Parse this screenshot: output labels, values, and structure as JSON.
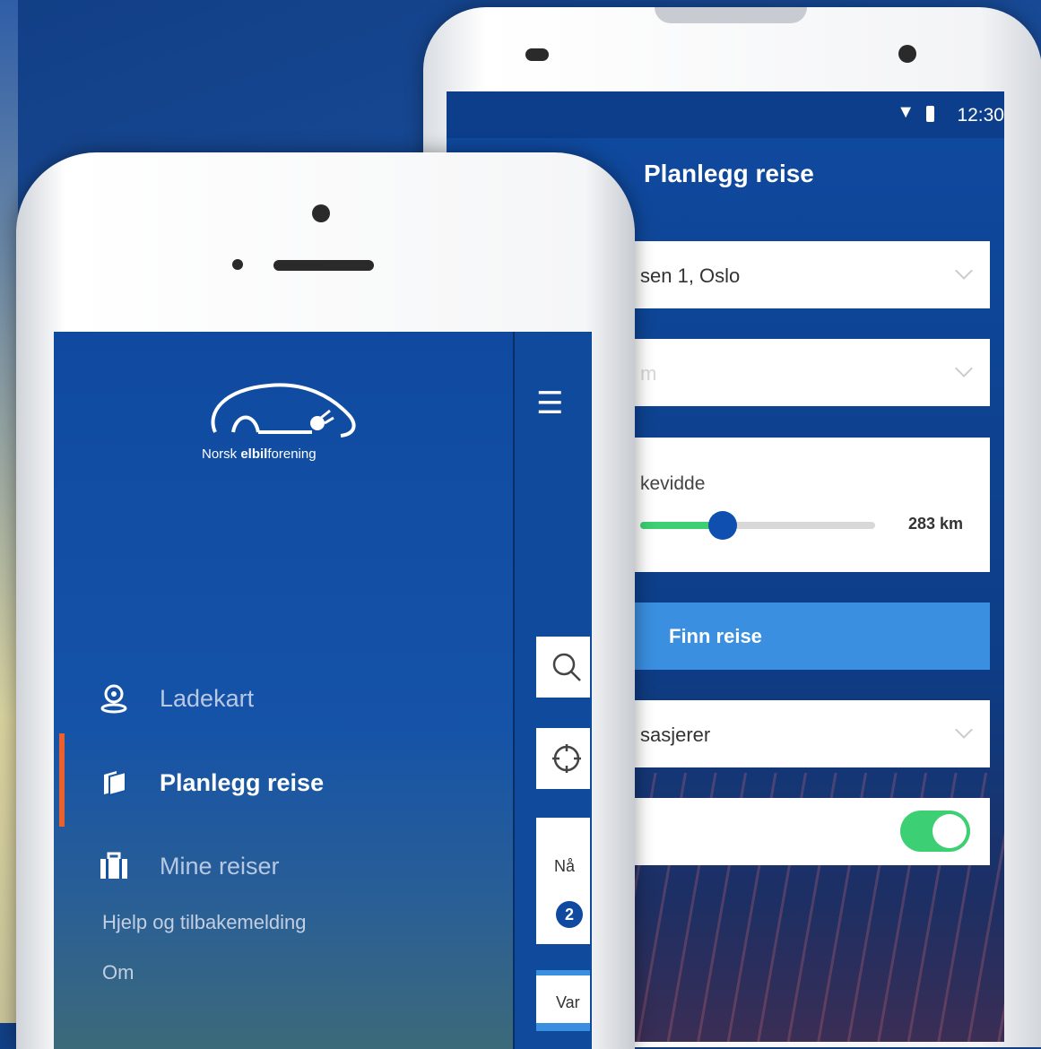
{
  "android": {
    "status": {
      "time": "12:30"
    },
    "title": "Planlegg reise",
    "from_text": "sen 1, Oslo",
    "to_text": "m",
    "range": {
      "label": "kevidde",
      "value_text": "283 km",
      "fill_fraction": 0.35
    },
    "find_button": "Finn reise",
    "passengers_text": "sasjerer",
    "toggle_on": true
  },
  "iphone": {
    "logo": {
      "brand_prefix": "Norsk ",
      "brand_bold": "elbil",
      "brand_suffix": "forening"
    },
    "menu": [
      {
        "label": "Ladekart",
        "icon": "location-pin-icon"
      },
      {
        "label": "Planlegg reise",
        "icon": "stack-icon",
        "active": true
      },
      {
        "label": "Mine reiser",
        "icon": "suitcase-icon"
      }
    ],
    "links": [
      "Hjelp og tilbakemelding",
      "Om"
    ],
    "peek": {
      "hamburger": "☰",
      "label_cut": "Nå",
      "badge": "2",
      "bottom_cut": "Var"
    }
  },
  "colors": {
    "primary": "#0f4aa0",
    "accent": "#3a8fe0",
    "success": "#3ccf74",
    "active_marker": "#e8612f"
  }
}
